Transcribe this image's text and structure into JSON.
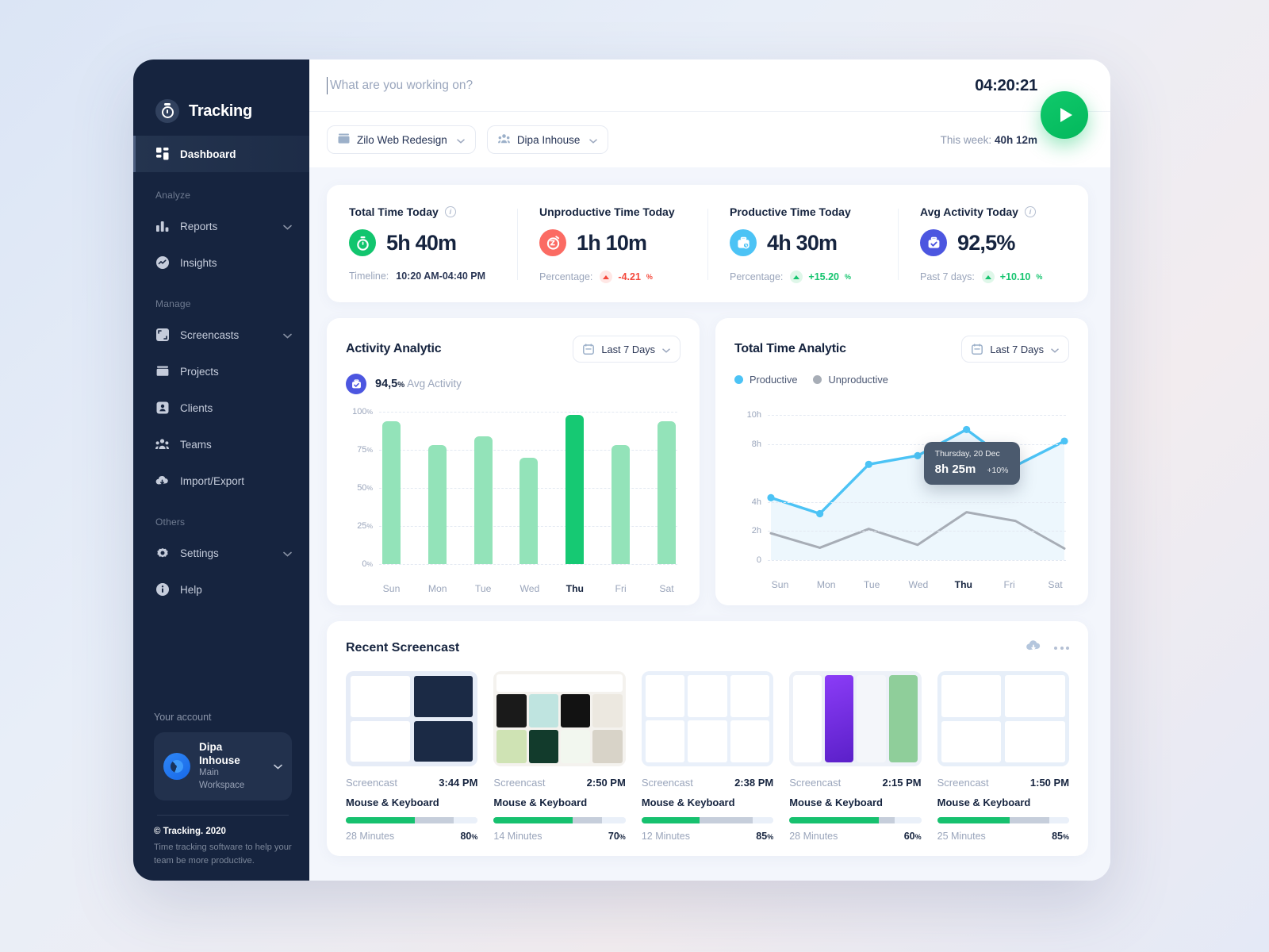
{
  "brand": {
    "name": "Tracking",
    "icon": "stopwatch-icon"
  },
  "sidebar": {
    "primary": [
      {
        "label": "Dashboard",
        "icon": "grid-icon",
        "active": true
      }
    ],
    "groups": [
      {
        "title": "Analyze",
        "items": [
          {
            "label": "Reports",
            "icon": "bar-chart-icon",
            "chevron": true
          },
          {
            "label": "Insights",
            "icon": "pulse-circle-icon",
            "chevron": false
          }
        ]
      },
      {
        "title": "Manage",
        "items": [
          {
            "label": "Screencasts",
            "icon": "screencast-icon",
            "chevron": true
          },
          {
            "label": "Projects",
            "icon": "folder-icon",
            "chevron": false
          },
          {
            "label": "Clients",
            "icon": "contact-card-icon",
            "chevron": false
          },
          {
            "label": "Teams",
            "icon": "people-icon",
            "chevron": false
          },
          {
            "label": "Import/Export",
            "icon": "cloud-download-icon",
            "chevron": false
          }
        ]
      },
      {
        "title": "Others",
        "items": [
          {
            "label": "Settings",
            "icon": "gear-icon",
            "chevron": true
          },
          {
            "label": "Help",
            "icon": "info-circle-icon",
            "chevron": false
          }
        ]
      }
    ],
    "account": {
      "title": "Your account",
      "name": "Dipa Inhouse",
      "workspace": "Main Workspace"
    },
    "footer": {
      "copyright": "© Tracking. 2020",
      "tagline": "Time tracking software to help your team be more productive."
    }
  },
  "topbar": {
    "task_placeholder": "What are you working on?",
    "task_value": "",
    "timer": "04:20:21",
    "project_pill": "Zilo Web Redesign",
    "client_pill": "Dipa Inhouse",
    "week_label": "This week:",
    "week_value": "40h 12m",
    "play_button": "start-timer"
  },
  "stats": [
    {
      "title": "Total Time Today",
      "has_info": true,
      "value": "5h 40m",
      "icon": "stopwatch-icon",
      "icon_color": "#12c56e",
      "foot_label": "Timeline:",
      "foot_value": "10:20 AM-04:40 PM",
      "foot_type": "text"
    },
    {
      "title": "Unproductive Time Today",
      "has_info": false,
      "value": "1h 10m",
      "icon": "sleep-clock-icon",
      "icon_color": "#fb6b63",
      "foot_label": "Percentage:",
      "foot_value": "-4.21",
      "foot_unit": "%",
      "foot_type": "delta",
      "delta_color": "#f4483c",
      "delta_bg": "#ffe7e5",
      "delta_dir": "up"
    },
    {
      "title": "Productive Time Today",
      "has_info": false,
      "value": "4h 30m",
      "icon": "briefcase-clock-icon",
      "icon_color": "#4cc3f5",
      "foot_label": "Percentage:",
      "foot_value": "+15.20",
      "foot_unit": "%",
      "foot_type": "delta",
      "delta_color": "#16c46f",
      "delta_bg": "#dff7e9",
      "delta_dir": "up"
    },
    {
      "title": "Avg Activity Today",
      "has_info": true,
      "value": "92,5%",
      "icon": "briefcase-check-icon",
      "icon_color": "#4c56e0",
      "foot_label": "Past 7 days:",
      "foot_value": "+10.10",
      "foot_unit": "%",
      "foot_type": "delta",
      "delta_color": "#16c46f",
      "delta_bg": "#dff7e9",
      "delta_dir": "up"
    }
  ],
  "activity_chart": {
    "title": "Activity Analytic",
    "range": "Last 7 Days",
    "avg_value": "94,5",
    "avg_unit": "%",
    "avg_label": "Avg Activity"
  },
  "total_time_chart": {
    "title": "Total Time Analytic",
    "range": "Last 7 Days",
    "legend": [
      {
        "label": "Productive",
        "color": "#4cc3f5"
      },
      {
        "label": "Unproductive",
        "color": "#a7adb6"
      }
    ],
    "tooltip": {
      "date": "Thursday, 20 Dec",
      "value": "8h 25m",
      "delta": "+10%"
    }
  },
  "chart_data": [
    {
      "type": "bar",
      "title": "Activity Analytic",
      "categories": [
        "Sun",
        "Mon",
        "Tue",
        "Wed",
        "Thu",
        "Fri",
        "Sat"
      ],
      "values": [
        94,
        78,
        84,
        70,
        98,
        78,
        94
      ],
      "highlight_index": 4,
      "ytick_labels": [
        "100%",
        "75%",
        "50%",
        "25%",
        "0%"
      ],
      "ytick_values": [
        100,
        75,
        50,
        25,
        0
      ],
      "ylim": [
        0,
        105
      ],
      "ylabel": "",
      "xlabel": "",
      "grid": true,
      "colors": {
        "bar": "#93e3b9",
        "highlight": "#16c973"
      }
    },
    {
      "type": "line",
      "title": "Total Time Analytic",
      "x": [
        "Sun",
        "Mon",
        "Tue",
        "Wed",
        "Thu",
        "Fri",
        "Sat"
      ],
      "ytick_labels": [
        "10h",
        "8h",
        "4h",
        "2h",
        "0"
      ],
      "ytick_values": [
        10,
        8,
        4,
        2,
        0
      ],
      "ylim": [
        0,
        10.5
      ],
      "grid": true,
      "legend_position": "top-left",
      "highlight_x": "Thu",
      "series": [
        {
          "name": "Productive",
          "color": "#4cc3f5",
          "values": [
            4.3,
            3.2,
            6.6,
            7.2,
            9.0,
            6.5,
            8.2
          ]
        },
        {
          "name": "Unproductive",
          "color": "#a7adb6",
          "values": [
            1.85,
            0.85,
            2.15,
            1.05,
            3.3,
            2.7,
            0.8
          ]
        }
      ],
      "annotation": {
        "x": "Thu",
        "date": "Thursday, 20 Dec",
        "value": "8h 25m",
        "delta": "+10%"
      }
    }
  ],
  "screencasts": {
    "title": "Recent Screencast",
    "actions": [
      "cloud-download-icon",
      "more-options-icon"
    ],
    "items": [
      {
        "name": "Screencast",
        "time": "3:44 PM",
        "source": "Mouse & Keyboard",
        "minutes": "28 Minutes",
        "percent": "80",
        "unit": "%",
        "bar": [
          52,
          30,
          18
        ],
        "theme": "dash"
      },
      {
        "name": "Screencast",
        "time": "2:50 PM",
        "source": "Mouse & Keyboard",
        "minutes": "14 Minutes",
        "percent": "70",
        "unit": "%",
        "bar": [
          60,
          22,
          18
        ],
        "theme": "gallery"
      },
      {
        "name": "Screencast",
        "time": "2:38 PM",
        "source": "Mouse & Keyboard",
        "minutes": "12 Minutes",
        "percent": "85",
        "unit": "%",
        "bar": [
          44,
          40,
          16
        ],
        "theme": "wire"
      },
      {
        "name": "Screencast",
        "time": "2:15 PM",
        "source": "Mouse & Keyboard",
        "minutes": "28 Minutes",
        "percent": "60",
        "unit": "%",
        "bar": [
          68,
          12,
          20
        ],
        "theme": "mobile"
      },
      {
        "name": "Screencast",
        "time": "1:50 PM",
        "source": "Mouse & Keyboard",
        "minutes": "25 Minutes",
        "percent": "85",
        "unit": "%",
        "bar": [
          55,
          30,
          15
        ],
        "theme": "table"
      }
    ]
  }
}
